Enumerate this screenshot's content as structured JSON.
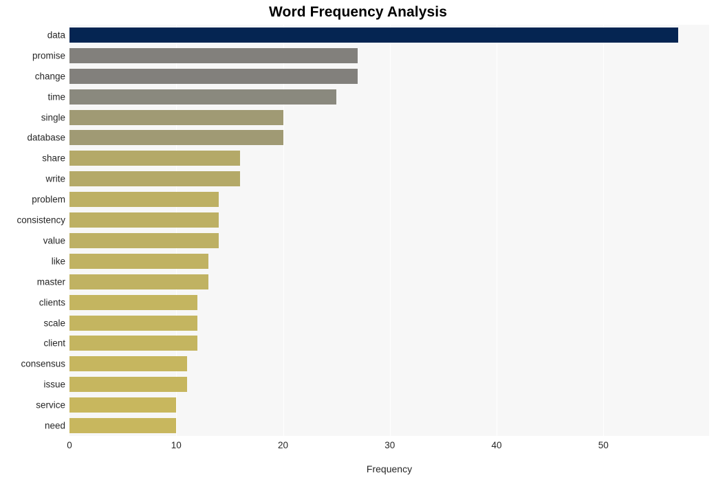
{
  "chart_data": {
    "type": "bar",
    "orientation": "horizontal",
    "title": "Word Frequency Analysis",
    "xlabel": "Frequency",
    "ylabel": "",
    "categories": [
      "data",
      "promise",
      "change",
      "time",
      "single",
      "database",
      "share",
      "write",
      "problem",
      "consistency",
      "value",
      "like",
      "master",
      "clients",
      "scale",
      "client",
      "consensus",
      "issue",
      "service",
      "need"
    ],
    "values": [
      57,
      27,
      27,
      25,
      20,
      20,
      16,
      16,
      14,
      14,
      14,
      13,
      13,
      12,
      12,
      12,
      11,
      11,
      10,
      10
    ],
    "bar_colors": [
      "#052552",
      "#82807c",
      "#82807c",
      "#8a897e",
      "#a09a74",
      "#a09a74",
      "#b4a968",
      "#b4a968",
      "#bdb064",
      "#bdb064",
      "#bdb064",
      "#c0b262",
      "#c0b262",
      "#c4b560",
      "#c4b560",
      "#c4b560",
      "#c6b65f",
      "#c6b65f",
      "#c8b75e",
      "#c8b75e"
    ],
    "xlim": [
      0,
      59.9
    ],
    "xticks": [
      0,
      10,
      20,
      30,
      40,
      50
    ],
    "xtick_labels": [
      "0",
      "10",
      "20",
      "30",
      "40",
      "50"
    ],
    "grid": true,
    "grid_axis": "x",
    "legend": null,
    "plot_background": "#f7f7f7",
    "figure_background": "#ffffff"
  }
}
